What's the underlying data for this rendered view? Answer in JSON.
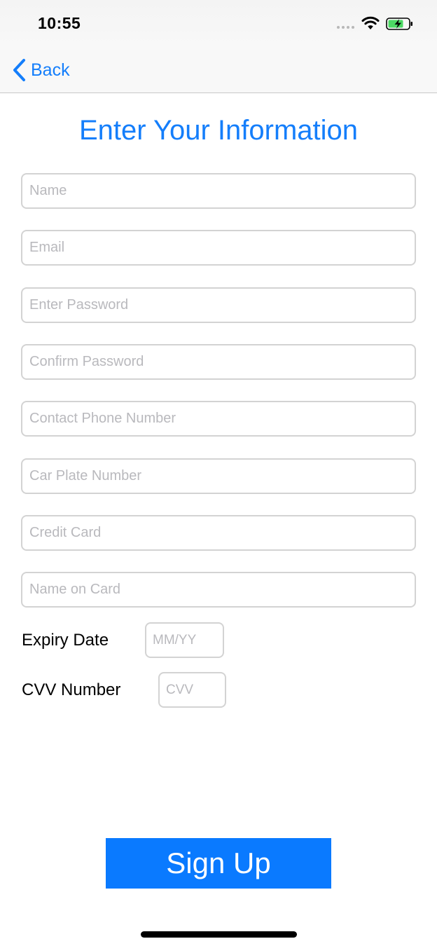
{
  "status_bar": {
    "time": "10:55"
  },
  "nav": {
    "back_label": "Back"
  },
  "page": {
    "title": "Enter Your Information"
  },
  "form": {
    "fields": [
      {
        "name": "name",
        "placeholder": "Name",
        "value": ""
      },
      {
        "name": "email",
        "placeholder": "Email",
        "value": ""
      },
      {
        "name": "enter-password",
        "placeholder": "Enter Password",
        "value": ""
      },
      {
        "name": "confirm-password",
        "placeholder": "Confirm Password",
        "value": ""
      },
      {
        "name": "contact-phone-number",
        "placeholder": "Contact Phone Number",
        "value": ""
      },
      {
        "name": "car-plate-number",
        "placeholder": "Car Plate Number",
        "value": ""
      },
      {
        "name": "credit-card",
        "placeholder": "Credit Card",
        "value": ""
      },
      {
        "name": "name-on-card",
        "placeholder": "Name on Card",
        "value": ""
      }
    ],
    "expiry": {
      "label": "Expiry Date",
      "placeholder": "MM/YY",
      "value": ""
    },
    "cvv": {
      "label": "CVV Number",
      "placeholder": "CVV",
      "value": ""
    }
  },
  "actions": {
    "signup_label": "Sign Up"
  },
  "colors": {
    "accent": "#147efb",
    "button": "#0a7aff",
    "field_border": "#d3d3d3",
    "placeholder": "#b9b9bd",
    "battery_charging": "#4cd964"
  },
  "icons": {
    "back": "chevron-left-icon",
    "wifi": "wifi-icon",
    "battery": "battery-charging-icon",
    "signal": "cellular-signal-icon"
  }
}
